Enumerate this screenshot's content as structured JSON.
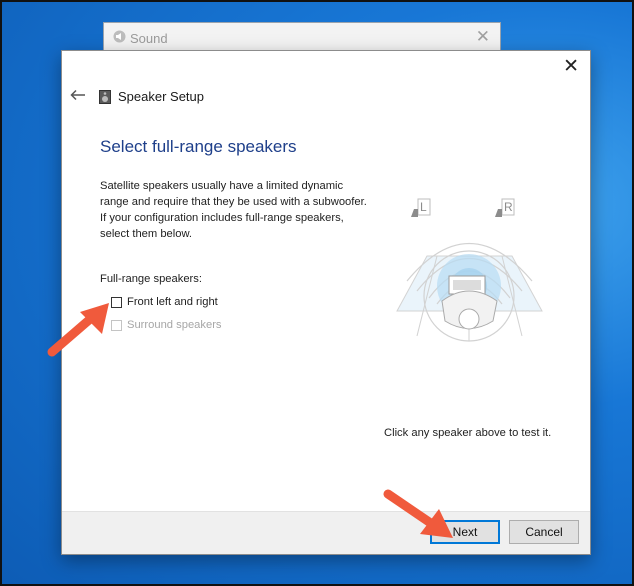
{
  "background_window": {
    "title": "Sound",
    "icon": "speaker-icon",
    "close_glyph": "✕"
  },
  "dialog": {
    "title": "Speaker Setup",
    "close_glyph": "✕",
    "heading": "Select full-range speakers",
    "description": "Satellite speakers usually have a limited dynamic range and require that they be used with a subwoofer.  If your configuration includes full-range speakers, select them below.",
    "group_label": "Full-range speakers:",
    "options": [
      {
        "label": "Front left and right",
        "checked": false,
        "enabled": true
      },
      {
        "label": "Surround speakers",
        "checked": false,
        "enabled": false
      }
    ],
    "speaker_diagram": {
      "left_label": "L",
      "right_label": "R"
    },
    "test_hint": "Click any speaker above to test it.",
    "buttons": {
      "next": "Next",
      "cancel": "Cancel"
    }
  },
  "annotation_color": "#f05a3c",
  "desktop_color": "#1877d6"
}
